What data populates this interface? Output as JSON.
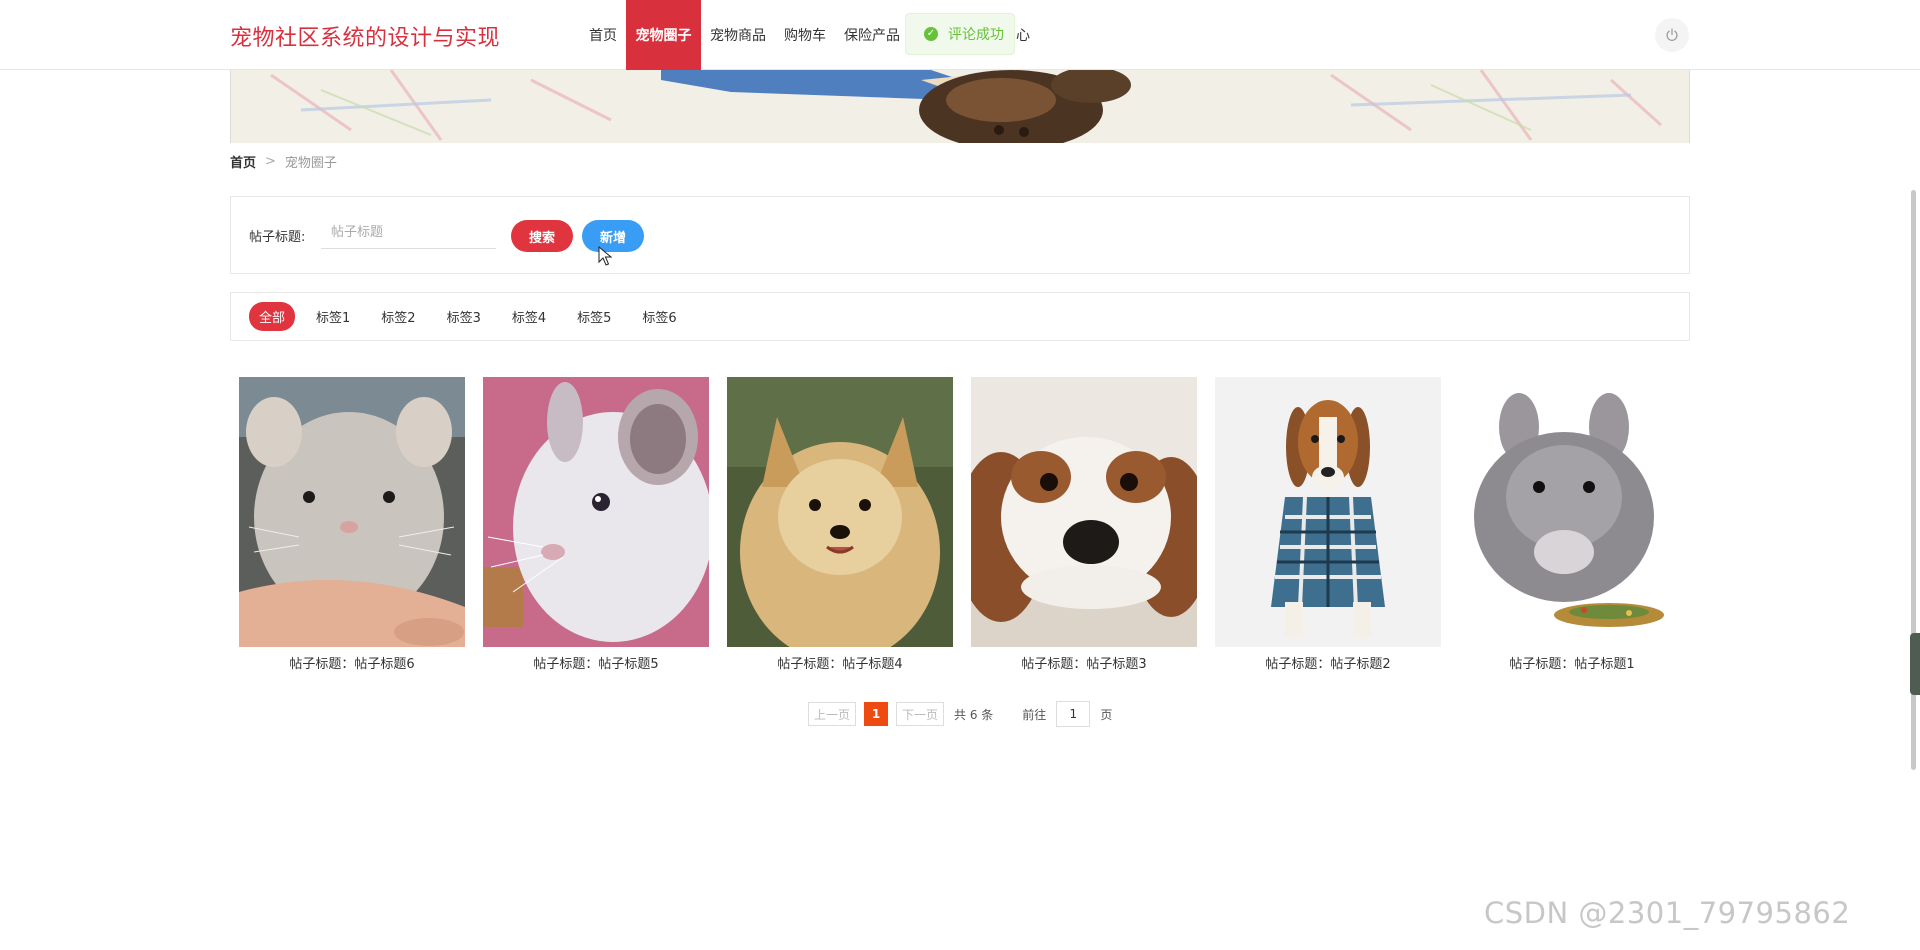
{
  "header": {
    "site_title": "宠物社区系统的设计与实现",
    "nav": [
      "首页",
      "宠物圈子",
      "宠物商品",
      "购物车",
      "保险产品",
      "人中心"
    ],
    "active_nav_index": 1,
    "toast": "评论成功",
    "power_icon": "power-icon"
  },
  "breadcrumb": {
    "home": "首页",
    "separator": ">",
    "current": "宠物圈子"
  },
  "search": {
    "label": "帖子标题:",
    "placeholder": "帖子标题",
    "value": "",
    "search_button": "搜索",
    "add_button": "新增"
  },
  "tags": [
    "全部",
    "标签1",
    "标签2",
    "标签3",
    "标签4",
    "标签5",
    "标签6"
  ],
  "active_tag_index": 0,
  "posts": [
    {
      "title": "帖子标题：帖子标题6",
      "image": "chinchilla-in-hand"
    },
    {
      "title": "帖子标题：帖子标题5",
      "image": "white-chinchilla-pink-background"
    },
    {
      "title": "帖子标题：帖子标题4",
      "image": "pomeranian-dog"
    },
    {
      "title": "帖子标题：帖子标题3",
      "image": "spaniel-puppy-lying"
    },
    {
      "title": "帖子标题：帖子标题2",
      "image": "beagle-in-plaid-shirt"
    },
    {
      "title": "帖子标题：帖子标题1",
      "image": "grey-chinchilla-with-seeds"
    }
  ],
  "pagination": {
    "prev": "上一页",
    "current_page": "1",
    "next": "下一页",
    "total": "共 6 条",
    "goto_label": "前往",
    "goto_value": "1",
    "page_suffix": "页"
  },
  "watermark": "CSDN @2301_79795862",
  "colors": {
    "brand": "#d9303e",
    "search_button": "#e0343f",
    "add_button": "#3a9df5",
    "pagination_active": "#ee4b12",
    "toast_text": "#67c23a"
  }
}
